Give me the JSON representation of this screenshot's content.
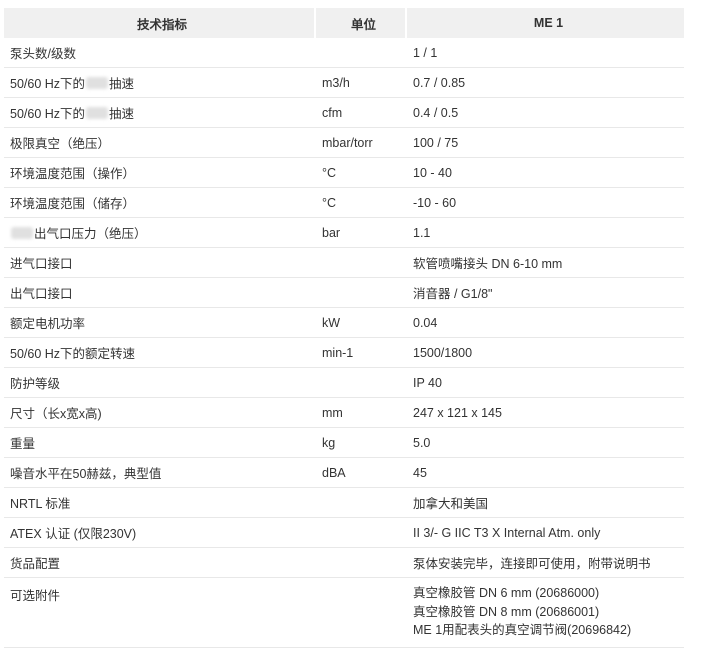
{
  "header": {
    "col1": "技术指标",
    "col2": "单位",
    "col3": "ME 1"
  },
  "rows": [
    {
      "name": "泵头数/级数",
      "unit": "",
      "value": "1 / 1"
    },
    {
      "name_pre": "50/60 Hz下的",
      "name_post": "抽速",
      "unit": "m3/h",
      "value": "0.7 / 0.85"
    },
    {
      "name_pre": "50/60 Hz下的",
      "name_post": "抽速",
      "unit": "cfm",
      "value": "0.4 / 0.5"
    },
    {
      "name": "极限真空（绝压）",
      "unit": "mbar/torr",
      "value": "100 / 75"
    },
    {
      "name": "环境温度范围（操作）",
      "unit": "°C",
      "value": "10 - 40"
    },
    {
      "name": "环境温度范围（储存）",
      "unit": "°C",
      "value": "-10 - 60"
    },
    {
      "name_post": "出气口压力（绝压）",
      "unit": "bar",
      "value": "1.1"
    },
    {
      "name": "进气口接口",
      "unit": "",
      "value": "软管喷嘴接头 DN 6-10 mm"
    },
    {
      "name": "出气口接口",
      "unit": "",
      "value": "消音器 / G1/8\""
    },
    {
      "name": "额定电机功率",
      "unit": "kW",
      "value": "0.04"
    },
    {
      "name": "50/60 Hz下的额定转速",
      "unit": "min-1",
      "value": "1500/1800"
    },
    {
      "name": "防护等级",
      "unit": "",
      "value": "IP 40"
    },
    {
      "name": "尺寸（长x宽x高)",
      "unit": "mm",
      "value": "247 x 121 x 145"
    },
    {
      "name": "重量",
      "unit": "kg",
      "value": "5.0"
    },
    {
      "name": "噪音水平在50赫兹，典型值",
      "unit": "dBA",
      "value": "45"
    },
    {
      "name": "NRTL 标准",
      "unit": "",
      "value": "加拿大和美国"
    },
    {
      "name": "ATEX 认证 (仅限230V)",
      "unit": "",
      "value": "II 3/- G IIC T3 X Internal Atm. only"
    },
    {
      "name": "货品配置",
      "unit": "",
      "value": "泵体安装完毕，连接即可使用，附带说明书"
    }
  ],
  "accessories": {
    "name": "可选附件",
    "unit": "",
    "items": [
      "真空橡胶管 DN 6 mm (20686000)",
      "真空橡胶管 DN 8 mm (20686001)",
      "ME 1用配表头的真空调节阀(20696842)"
    ]
  }
}
